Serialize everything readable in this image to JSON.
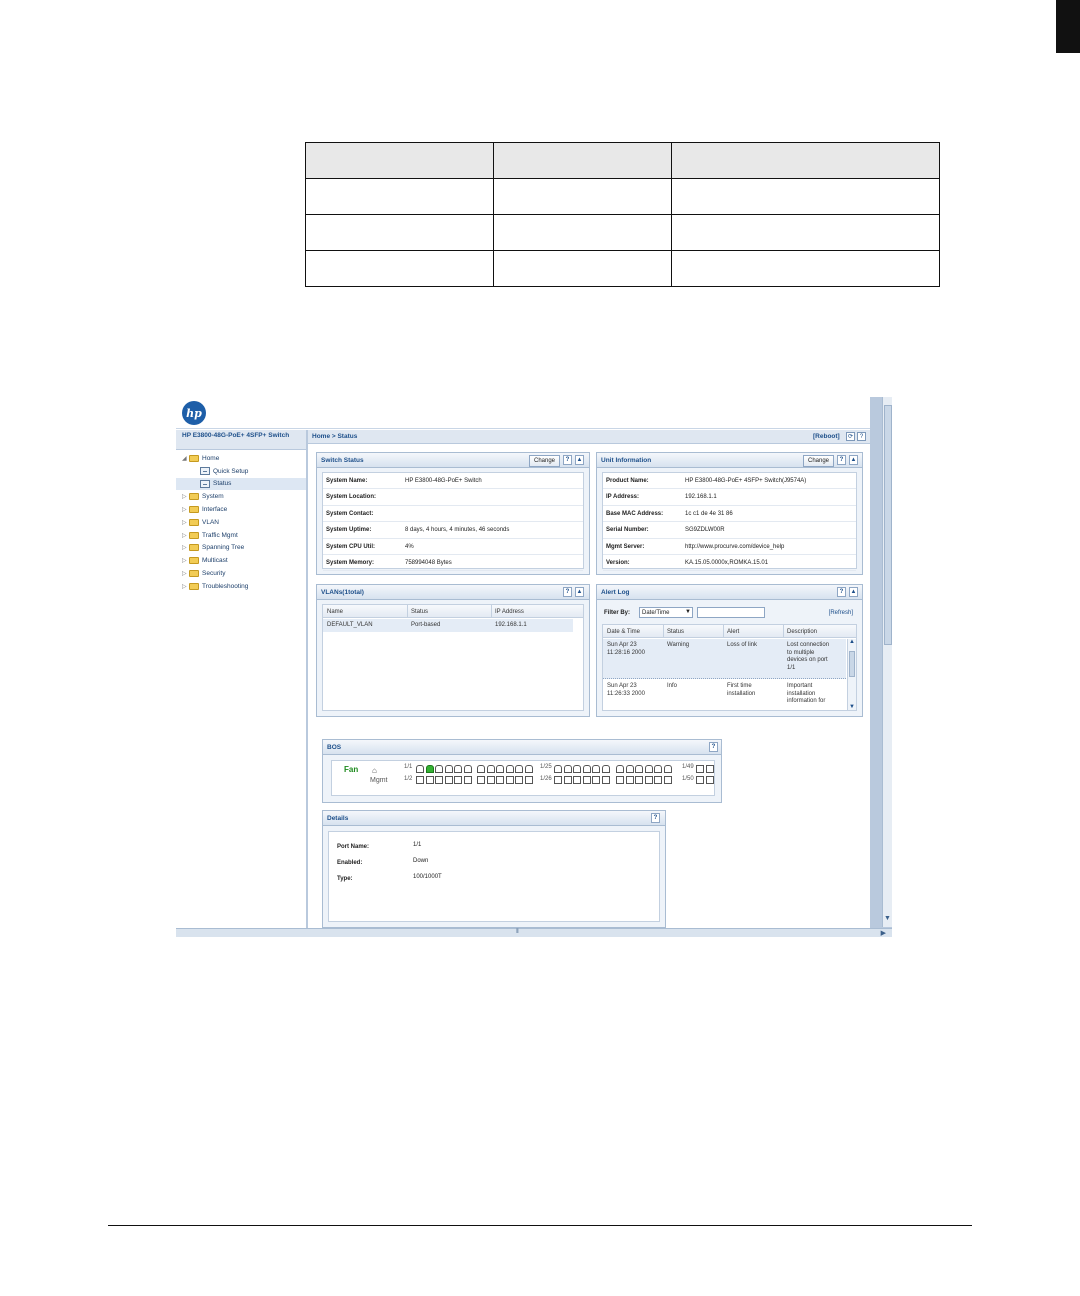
{
  "doc_table": {
    "rows": [
      [
        "",
        "",
        ""
      ],
      [
        "",
        "",
        ""
      ],
      [
        "",
        "",
        ""
      ],
      [
        "",
        "",
        ""
      ]
    ]
  },
  "screenshot": {
    "logo_text": "hp",
    "switch_title": "HP E3800-48G-PoE+ 4SFP+ Switch",
    "breadcrumb": "Home > Status",
    "reboot_label": "[Reboot]",
    "nav": [
      {
        "label": "Home",
        "type": "folder",
        "expanded": true
      },
      {
        "label": "Quick Setup",
        "type": "page",
        "child": true
      },
      {
        "label": "Status",
        "type": "page",
        "child": true,
        "selected": true
      },
      {
        "label": "System",
        "type": "folder"
      },
      {
        "label": "Interface",
        "type": "folder"
      },
      {
        "label": "VLAN",
        "type": "folder"
      },
      {
        "label": "Traffic Mgmt",
        "type": "folder"
      },
      {
        "label": "Spanning Tree",
        "type": "folder"
      },
      {
        "label": "Multicast",
        "type": "folder"
      },
      {
        "label": "Security",
        "type": "folder"
      },
      {
        "label": "Troubleshooting",
        "type": "folder"
      }
    ],
    "switch_status": {
      "title": "Switch Status",
      "change_label": "Change",
      "rows": [
        {
          "key": "System Name:",
          "value": "HP E3800-48G-PoE+ Switch"
        },
        {
          "key": "System Location:",
          "value": ""
        },
        {
          "key": "System Contact:",
          "value": ""
        },
        {
          "key": "System Uptime:",
          "value": "8 days, 4 hours, 4 minutes, 46 seconds"
        },
        {
          "key": "System CPU Util:",
          "value": "4%"
        },
        {
          "key": "System Memory:",
          "value": "758994048 Bytes"
        }
      ]
    },
    "unit_info": {
      "title": "Unit Information",
      "change_label": "Change",
      "rows": [
        {
          "key": "Product Name:",
          "value": "HP E3800-48G-PoE+ 4SFP+ Switch(J9574A)"
        },
        {
          "key": "IP Address:",
          "value": "192.168.1.1"
        },
        {
          "key": "Base MAC Address:",
          "value": "1c c1 de 4e 31 86"
        },
        {
          "key": "Serial Number:",
          "value": "SG9ZDLW00R"
        },
        {
          "key": "Mgmt Server:",
          "value": "http://www.procurve.com/device_help"
        },
        {
          "key": "Version:",
          "value": "KA.15.05.0000x,ROMKA.15.01"
        }
      ]
    },
    "vlans": {
      "title": "VLANs(1total)",
      "columns": [
        "Name",
        "Status",
        "IP Address"
      ],
      "rows": [
        [
          "DEFAULT_VLAN",
          "Port-based",
          "192.168.1.1"
        ]
      ]
    },
    "alert_log": {
      "title": "Alert Log",
      "filter_label": "Filter By:",
      "filter_value": "Date/Time",
      "refresh_label": "[Refresh]",
      "columns": [
        "Date & Time",
        "Status",
        "Alert",
        "Description"
      ],
      "rows": [
        [
          "Sun Apr 23\n11:28:16 2000",
          "Warning",
          "Loss of link",
          "Lost connection\nto multiple\ndevices on port\n1/1"
        ],
        [
          "Sun Apr 23\n11:26:33 2000",
          "Info",
          "First time\ninstallation",
          "Important\ninstallation\ninformation for"
        ]
      ]
    },
    "bos": {
      "title": "BOS",
      "fan_label": "Fan",
      "mgmt_label": "Mgmt",
      "port_labels": [
        "1/1",
        "1/2",
        "1/25",
        "1/26",
        "1/49",
        "1/50"
      ],
      "active_port": "1/1"
    },
    "details": {
      "title": "Details",
      "rows": [
        {
          "key": "Port Name:",
          "value": "1/1"
        },
        {
          "key": "Enabled:",
          "value": "Down"
        },
        {
          "key": "Type:",
          "value": "100/1000T"
        }
      ]
    }
  }
}
